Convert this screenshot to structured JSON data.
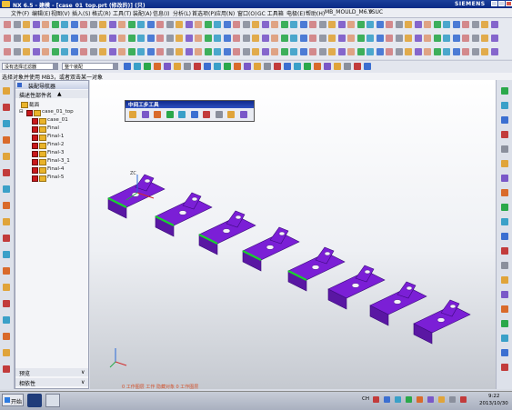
{
  "window": {
    "title": "NX 6.5 - 建模 - [case_01_top.prt (修改的)]     (只)",
    "brand": "SIEMENS"
  },
  "menu": [
    "文件(F)",
    "编辑(E)",
    "视图(V)",
    "插入(S)",
    "格式(R)",
    "工具(T)",
    "装配(A)",
    "信息(I)",
    "分析(L)",
    "首选项(P)",
    "应用(N)",
    "窗口(O)",
    "GC 工具箱",
    "电极(E)",
    "帮助(H)",
    "MB_MOULD_M6.9",
    "YSUC"
  ],
  "filter": {
    "selection_filter": "没有选择过滤器",
    "assembly_scope": "整个装配"
  },
  "prompt": "选择对象并使用 MB3，或者双击某一对象",
  "navigator": {
    "title": "装配导航器",
    "column_header": "描述性部件名",
    "tree": [
      {
        "label": "截面",
        "level": 0,
        "type": "folder"
      },
      {
        "label": "case_01_top",
        "level": 0,
        "type": "assembly"
      },
      {
        "label": "case_01",
        "level": 1,
        "type": "part"
      },
      {
        "label": "Final",
        "level": 1,
        "type": "part"
      },
      {
        "label": "Final-1",
        "level": 1,
        "type": "part"
      },
      {
        "label": "Final-2",
        "level": 1,
        "type": "part"
      },
      {
        "label": "Final-3",
        "level": 1,
        "type": "part"
      },
      {
        "label": "Final-3_1",
        "level": 1,
        "type": "part"
      },
      {
        "label": "Final-4",
        "level": 1,
        "type": "part"
      },
      {
        "label": "Final-5",
        "level": 1,
        "type": "part"
      }
    ],
    "footer": [
      "预览",
      "相依性"
    ]
  },
  "floating_toolbar": {
    "title": "中间工步工具"
  },
  "viewport": {
    "status_text": "0 工作图层  工作  隐藏对象  0 工作图层",
    "triad_label": "ZC"
  },
  "taskbar": {
    "start": "开始",
    "time": "9:22",
    "date": "2013/10/30",
    "lang": "CH"
  },
  "colors": {
    "part_purple": "#7b1fd6",
    "part_edge": "#3a0b7a",
    "accent_green": "#19d12e",
    "titlebar_blue": "#0a2a86"
  }
}
